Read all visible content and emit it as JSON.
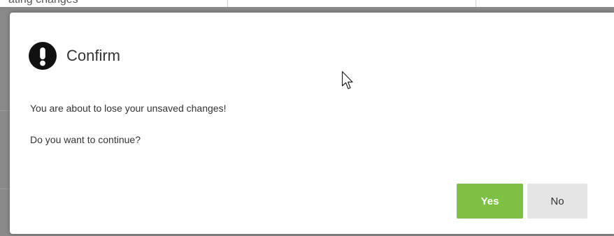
{
  "background": {
    "partial_text": "ating changes"
  },
  "dialog": {
    "title": "Confirm",
    "icon": "exclamation-circle-icon",
    "message_line1": "You are about to lose your unsaved changes!",
    "message_line2": "Do you want to continue?",
    "yes_label": "Yes",
    "no_label": "No"
  },
  "colors": {
    "yes_button": "#7dc043",
    "no_button": "#e5e5e5",
    "icon": "#111111",
    "text": "#333333"
  }
}
